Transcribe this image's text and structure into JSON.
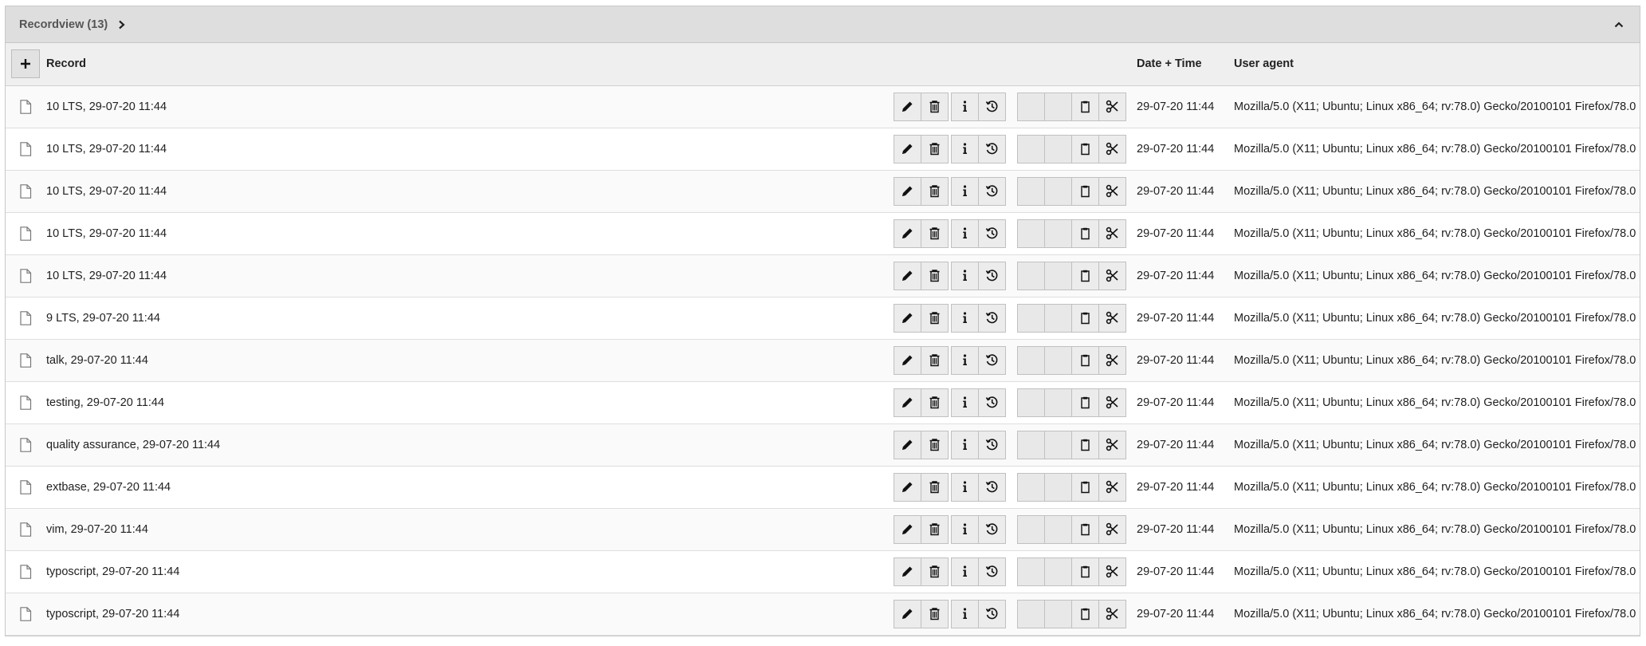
{
  "panel": {
    "title": "Recordview (13)"
  },
  "table": {
    "headers": {
      "record": "Record",
      "datetime": "Date + Time",
      "useragent": "User agent"
    },
    "rows": [
      {
        "record": "10 LTS, 29-07-20 11:44",
        "datetime": "29-07-20 11:44",
        "useragent": "Mozilla/5.0 (X11; Ubuntu; Linux x86_64; rv:78.0) Gecko/20100101 Firefox/78.0"
      },
      {
        "record": "10 LTS, 29-07-20 11:44",
        "datetime": "29-07-20 11:44",
        "useragent": "Mozilla/5.0 (X11; Ubuntu; Linux x86_64; rv:78.0) Gecko/20100101 Firefox/78.0"
      },
      {
        "record": "10 LTS, 29-07-20 11:44",
        "datetime": "29-07-20 11:44",
        "useragent": "Mozilla/5.0 (X11; Ubuntu; Linux x86_64; rv:78.0) Gecko/20100101 Firefox/78.0"
      },
      {
        "record": "10 LTS, 29-07-20 11:44",
        "datetime": "29-07-20 11:44",
        "useragent": "Mozilla/5.0 (X11; Ubuntu; Linux x86_64; rv:78.0) Gecko/20100101 Firefox/78.0"
      },
      {
        "record": "10 LTS, 29-07-20 11:44",
        "datetime": "29-07-20 11:44",
        "useragent": "Mozilla/5.0 (X11; Ubuntu; Linux x86_64; rv:78.0) Gecko/20100101 Firefox/78.0"
      },
      {
        "record": "9 LTS, 29-07-20 11:44",
        "datetime": "29-07-20 11:44",
        "useragent": "Mozilla/5.0 (X11; Ubuntu; Linux x86_64; rv:78.0) Gecko/20100101 Firefox/78.0"
      },
      {
        "record": "talk, 29-07-20 11:44",
        "datetime": "29-07-20 11:44",
        "useragent": "Mozilla/5.0 (X11; Ubuntu; Linux x86_64; rv:78.0) Gecko/20100101 Firefox/78.0"
      },
      {
        "record": "testing, 29-07-20 11:44",
        "datetime": "29-07-20 11:44",
        "useragent": "Mozilla/5.0 (X11; Ubuntu; Linux x86_64; rv:78.0) Gecko/20100101 Firefox/78.0"
      },
      {
        "record": "quality assurance, 29-07-20 11:44",
        "datetime": "29-07-20 11:44",
        "useragent": "Mozilla/5.0 (X11; Ubuntu; Linux x86_64; rv:78.0) Gecko/20100101 Firefox/78.0"
      },
      {
        "record": "extbase, 29-07-20 11:44",
        "datetime": "29-07-20 11:44",
        "useragent": "Mozilla/5.0 (X11; Ubuntu; Linux x86_64; rv:78.0) Gecko/20100101 Firefox/78.0"
      },
      {
        "record": "vim, 29-07-20 11:44",
        "datetime": "29-07-20 11:44",
        "useragent": "Mozilla/5.0 (X11; Ubuntu; Linux x86_64; rv:78.0) Gecko/20100101 Firefox/78.0"
      },
      {
        "record": "typoscript, 29-07-20 11:44",
        "datetime": "29-07-20 11:44",
        "useragent": "Mozilla/5.0 (X11; Ubuntu; Linux x86_64; rv:78.0) Gecko/20100101 Firefox/78.0"
      },
      {
        "record": "typoscript, 29-07-20 11:44",
        "datetime": "29-07-20 11:44",
        "useragent": "Mozilla/5.0 (X11; Ubuntu; Linux x86_64; rv:78.0) Gecko/20100101 Firefox/78.0"
      }
    ]
  },
  "icons": {
    "title_chevron": "chevron-right-icon",
    "collapse": "chevron-up-icon",
    "add": "plus-icon",
    "row_type": "document-icon",
    "edit": "pencil-icon",
    "delete": "trash-icon",
    "info": "info-icon",
    "history": "history-icon",
    "clipboard": "clipboard-icon",
    "cut": "scissors-icon"
  },
  "colors": {
    "header_bg": "#dedede",
    "table_head_bg": "#efefef",
    "button_bg": "#ececec",
    "border": "#c8c8c8"
  }
}
